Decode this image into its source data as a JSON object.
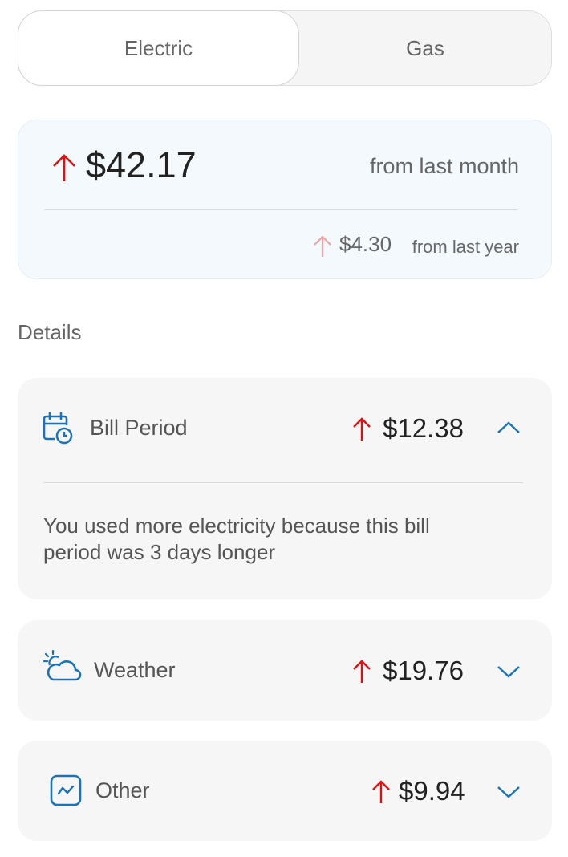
{
  "tabs": [
    {
      "label": "Electric",
      "active": true
    },
    {
      "label": "Gas",
      "active": false
    }
  ],
  "summary": {
    "amount": "$42.17",
    "period": "from last month",
    "secondary_amount": "$4.30",
    "secondary_period": "from last year"
  },
  "details": {
    "title": "Details",
    "items": [
      {
        "label": "Bill Period",
        "amount": "$12.38",
        "icon": "calendar-clock-icon",
        "expanded": true,
        "description": "You used more electricity because this bill period was 3 days longer"
      },
      {
        "label": "Weather",
        "amount": "$19.76",
        "icon": "weather-icon",
        "expanded": false
      },
      {
        "label": "Other",
        "amount": "$9.94",
        "icon": "chart-icon",
        "expanded": false
      }
    ]
  },
  "colors": {
    "increase": "#dd1111",
    "increase_light": "#f0a0a0",
    "accent": "#1a73b8",
    "card_bg": "#f6f6f6",
    "summary_bg": "#f4f9fd"
  }
}
